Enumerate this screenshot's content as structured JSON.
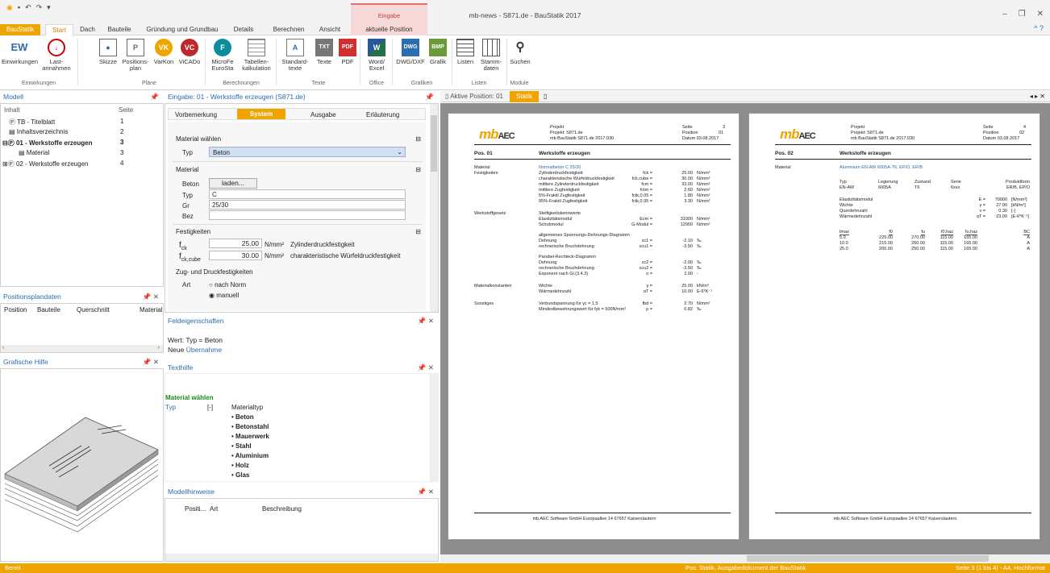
{
  "app": {
    "title": "mb-news - S871.de - BauStatik 2017",
    "context_group": "Eingabe",
    "qa_icons": [
      "app-logo",
      "save",
      "undo",
      "redo",
      "dropdown"
    ]
  },
  "tabs": [
    "BauStatik",
    "Start",
    "Dach",
    "Bauteile",
    "Gründung und Grundbau",
    "Details",
    "Berechnen",
    "Ansicht",
    "aktuelle Position"
  ],
  "ribbon": {
    "buttons": [
      {
        "label": "EW",
        "l2": "Einwirkungen",
        "icon": "ew-icon"
      },
      {
        "label": "Last-",
        "l2": "annahmen",
        "icon": "last-icon"
      },
      {
        "label": "Skizze",
        "l2": "",
        "icon": "skizze-icon"
      },
      {
        "label": "Positions-",
        "l2": "plan",
        "icon": "positionsplan-icon"
      },
      {
        "label": "VarKon",
        "l2": "",
        "icon": "varkon-icon"
      },
      {
        "label": "ViCADo",
        "l2": "",
        "icon": "vicado-icon"
      },
      {
        "label": "MicroFe",
        "l2": "EuroSta",
        "icon": "microfe-icon"
      },
      {
        "label": "Tabellen-",
        "l2": "kalkulation",
        "icon": "table-icon"
      },
      {
        "label": "Standard-",
        "l2": "texte",
        "icon": "standardtexte-icon"
      },
      {
        "label": "Texte",
        "l2": "",
        "icon": "txt-icon"
      },
      {
        "label": "PDF",
        "l2": "",
        "icon": "pdf-icon"
      },
      {
        "label": "Word/",
        "l2": "Excel",
        "icon": "word-excel-icon"
      },
      {
        "label": "DWG/DXF",
        "l2": "",
        "icon": "dwg-icon"
      },
      {
        "label": "Grafik",
        "l2": "",
        "icon": "bmp-icon"
      },
      {
        "label": "Listen",
        "l2": "",
        "icon": "listen-icon"
      },
      {
        "label": "Stamm-",
        "l2": "daten",
        "icon": "stammdaten-icon"
      },
      {
        "label": "Suchen",
        "l2": "",
        "icon": "binoculars-icon"
      }
    ],
    "groups": [
      "Einwirkungen",
      "Pläne",
      "Berechnungen",
      "Texte",
      "Office",
      "Grafiken",
      "Listen",
      "Module"
    ]
  },
  "modell": {
    "title": "Modell",
    "col_inhalt": "Inhalt",
    "col_seite": "Seite",
    "items": [
      {
        "label": "TB - Titelblatt",
        "page": "1"
      },
      {
        "label": "Inhaltsverzeichnis",
        "page": "2"
      },
      {
        "label": "01 - Werkstoffe erzeugen",
        "page": "3"
      },
      {
        "label": "Material",
        "page": "3"
      },
      {
        "label": "02 - Werkstoffe erzeugen",
        "page": "4"
      }
    ]
  },
  "positionsplandaten": {
    "title": "Positionsplandaten",
    "cols": [
      "Position",
      "Bauteile",
      "Querschnitt",
      "Material"
    ]
  },
  "grafische_hilfe": {
    "title": "Grafische Hilfe"
  },
  "eingabe": {
    "title": "Eingabe: 01 - Werkstoffe erzeugen (S871.de)",
    "tabs": [
      "Vorbemerkung",
      "System",
      "Ausgabe",
      "Erläuterung"
    ],
    "sec_material_waehlen": "Material wählen",
    "typ_label": "Typ",
    "typ_value": "Beton",
    "sec_material": "Material",
    "beton_label": "Beton",
    "laden": "laden...",
    "typ2_label": "Typ",
    "typ2_value": "C",
    "gr_label": "Gr",
    "gr_value": "25/30",
    "bez_label": "Bez",
    "bez_value": "",
    "sec_festigkeiten": "Festigkeiten",
    "fck_label": "f",
    "fck_sub": "ck",
    "fck_value": "25.00",
    "fck_unit": "N/mm²",
    "fck_desc": "Zylinderdruckfestigkeit",
    "fckc_label": "f",
    "fckc_sub": "ck,cube",
    "fckc_value": "30.00",
    "fckc_unit": "N/mm²",
    "fckc_desc": "charakteristische Würfeldruckfestigkeit",
    "sec_zug": "Zug- und Druckfestigkeiten",
    "art_label": "Art",
    "opt1": "nach Norm",
    "opt2": "manuell"
  },
  "feld": {
    "title": "Feldeigenschaften",
    "wert": "Wert: Typ = Beton",
    "neue": "Neue",
    "uebernahme": "Übernahme"
  },
  "texthilfe": {
    "title": "Texthilfe",
    "heading": "Material wählen",
    "typ": "Typ",
    "bracket": "[-]",
    "mtyp": "Materialtyp",
    "items": [
      "• Beton",
      "• Betonstahl",
      "• Mauerwerk",
      "• Stahl",
      "• Aluminium",
      "• Holz",
      "• Glas"
    ]
  },
  "modellhinweise": {
    "title": "Modellhinweise",
    "cols": [
      "Positi...",
      "Art",
      "Beschreibung"
    ]
  },
  "viewer": {
    "tab1": "Aktive Position: 01",
    "tab2": "Statik",
    "nav": "◂ ▸ ✕"
  },
  "page1": {
    "projekt": "Projekt",
    "projekt_val": "Projekt: S871.de",
    "file": "mb BauStatik S871.de 2017.030",
    "seite": "Seite",
    "seite_val": "3",
    "position": "Position",
    "position_val": "01",
    "datum": "Datum 03.08.2017",
    "pos": "Pos. 01",
    "pos_title": "Werkstoffe erzeugen",
    "rows": [
      {
        "l": "Material",
        "c": "Normalbeton C 25/30",
        "s": "",
        "v": "",
        "u": ""
      },
      {
        "l": "Festigkeiten",
        "c": "Zylinderdruckfestigkeit",
        "s": "fck =",
        "v": "25.00",
        "u": "N/mm²"
      },
      {
        "l": "",
        "c": "charakteristische Würfeldruckfestigkeit",
        "s": "fck,cube =",
        "v": "30.00",
        "u": "N/mm²"
      },
      {
        "l": "",
        "c": "mittlere Zylinderdruckfestigkeit",
        "s": "fcm =",
        "v": "33.00",
        "u": "N/mm²"
      },
      {
        "l": "",
        "c": "mittlere Zugfestigkeit",
        "s": "fctm =",
        "v": "2.60",
        "u": "N/mm²"
      },
      {
        "l": "",
        "c": "5%-Fraktil Zugfestigkeit",
        "s": "fctk,0.05 =",
        "v": "1.80",
        "u": "N/mm²"
      },
      {
        "l": "",
        "c": "95%-Fraktil Zugfestigkeit",
        "s": "fctk,0.95 =",
        "v": "3.30",
        "u": "N/mm²"
      },
      {
        "l": "Werkstoffgesetz",
        "c": "Steifigkeitskennwerte",
        "s": "",
        "v": "",
        "u": ""
      },
      {
        "l": "",
        "c": "Elastizitätsmodul",
        "s": "Ecm =",
        "v": "31000",
        "u": "N/mm²"
      },
      {
        "l": "",
        "c": "Schubmodul",
        "s": "G-Modul =",
        "v": "12900",
        "u": "N/mm²"
      },
      {
        "l": "",
        "c": "allgemeines Spannungs-Dehnungs-Diagramm",
        "s": "",
        "v": "",
        "u": ""
      },
      {
        "l": "",
        "c": "Dehnung",
        "s": "εc1 =",
        "v": "-2.10",
        "u": "‰"
      },
      {
        "l": "",
        "c": "rechnerische Bruchdehnung",
        "s": "εcu1 =",
        "v": "-3.50",
        "u": "‰"
      },
      {
        "l": "",
        "c": "Parabel-Rechteck-Diagramm",
        "s": "",
        "v": "",
        "u": ""
      },
      {
        "l": "",
        "c": "Dehnung",
        "s": "εc2 =",
        "v": "-2.00",
        "u": "‰"
      },
      {
        "l": "",
        "c": "rechnerische Bruchdehnung",
        "s": "εcu2 =",
        "v": "-3.50",
        "u": "‰"
      },
      {
        "l": "",
        "c": "Exponent nach Gl.(3.4.3)",
        "s": "n =",
        "v": "2.00",
        "u": "-"
      },
      {
        "l": "Materialkonstanten",
        "c": "Wichte",
        "s": "γ =",
        "v": "25.00",
        "u": "kN/m³"
      },
      {
        "l": "",
        "c": "Wärmedehnzahl",
        "s": "αT =",
        "v": "10.00",
        "u": "E-6*K⁻¹"
      },
      {
        "l": "Sonstiges",
        "c": "Verbundspannung für γc = 1,5",
        "s": "fbd =",
        "v": "2.70",
        "u": "N/mm²"
      },
      {
        "l": "",
        "c": "Mindestbewehrungswert für fyk = 500N/mm²",
        "s": "ρ =",
        "v": "0.82",
        "u": "‰"
      }
    ],
    "footer": "mb AEC Software GmbH   Europaallee 14   67657 Kaiserslautern"
  },
  "page2": {
    "projekt_val": "Projekt: S871.de",
    "file": "mb BauStatik S871.de 2017.030",
    "seite_val": "4",
    "position_val": "02",
    "datum": "Datum 03.08.2017",
    "pos": "Pos. 02",
    "pos_title": "Werkstoffe erzeugen",
    "mat_l": "Material",
    "mat": "Aluminium EN-AW 6005A-T6, EP/O, ER/B",
    "th": [
      "Typ",
      "Legierung",
      "Zustand",
      "Serie",
      "Produktform"
    ],
    "tr": [
      "EN-AW",
      "6005A",
      "T6",
      "6xxx",
      "ER/B, EP/O"
    ],
    "props": [
      {
        "c": "Elastizitätsmodul",
        "s": "E =",
        "v": "70000",
        "u": "[N/mm²]"
      },
      {
        "c": "Wichte",
        "s": "γ =",
        "v": "27.00",
        "u": "[kN/m³]"
      },
      {
        "c": "Querdehnzahl",
        "s": "ν =",
        "v": "0.30",
        "u": "[-]"
      },
      {
        "c": "Wärmedehnzahl",
        "s": "αT =",
        "v": "23.00",
        "u": "[E-6*K⁻¹]"
      }
    ],
    "th2": [
      "tmax",
      "f0",
      "fu",
      "f0,haz",
      "fu,haz",
      "BC"
    ],
    "tr2": [
      [
        "5.0",
        "225.00",
        "270.00",
        "115.00",
        "165.00",
        "A"
      ],
      [
        "10.0",
        "215.00",
        "260.00",
        "115.00",
        "165.00",
        "A"
      ],
      [
        "25.0",
        "200.00",
        "250.00",
        "115.00",
        "165.00",
        "A"
      ]
    ],
    "footer": "mb AEC Software GmbH   Europaallee 14   67657 Kaiserslautern"
  },
  "status": {
    "left": "Bereit",
    "center": "Pos. Statik, Ausgabedokument der BauStatik",
    "right": "Seite 3 (1 bis 4) - A4, Hochformat"
  },
  "colors": {
    "accent": "#f0a400",
    "link": "#2a6db0"
  }
}
